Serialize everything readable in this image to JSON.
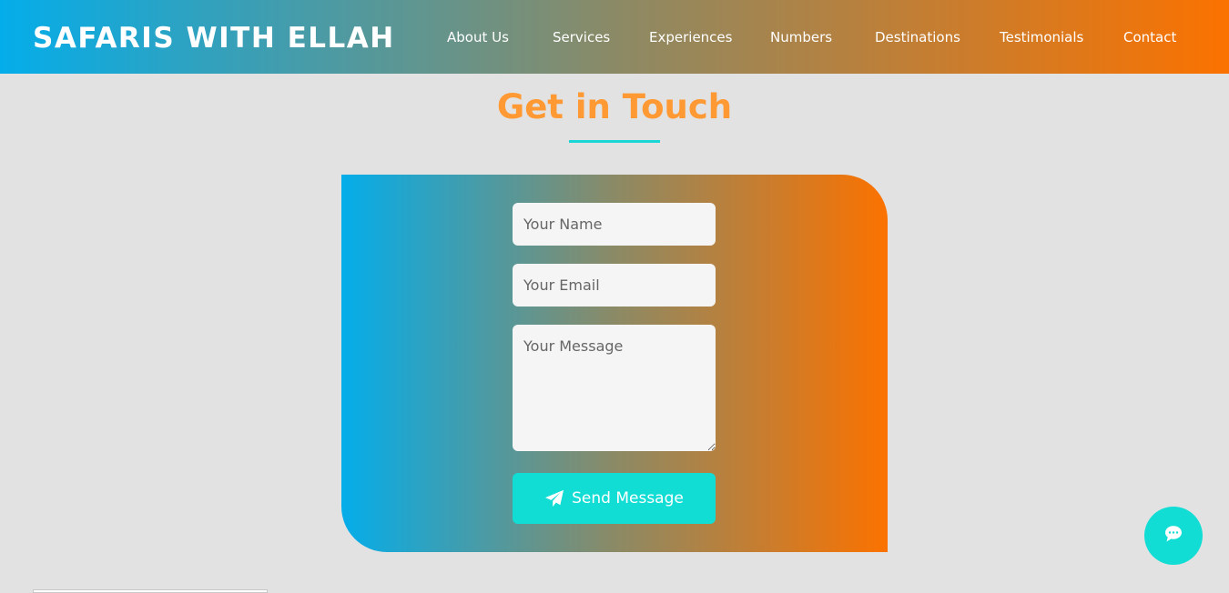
{
  "brand": {
    "title": "SAFARIS WITH ELLAH"
  },
  "nav": {
    "items": [
      {
        "label": "About Us"
      },
      {
        "label": "Services"
      },
      {
        "label": "Experiences"
      },
      {
        "label": "Numbers"
      },
      {
        "label": "Destinations"
      },
      {
        "label": "Testimonials"
      },
      {
        "label": "Contact"
      }
    ]
  },
  "contact": {
    "heading": "Get in Touch",
    "name_placeholder": "Your Name",
    "email_placeholder": "Your Email",
    "message_placeholder": "Your Message",
    "send_label": "Send Message",
    "send_icon": "paper-plane-icon"
  },
  "chat": {
    "icon": "chat-bubble-icon"
  },
  "colors": {
    "gradient_start": "#04adea",
    "gradient_end": "#fb7200",
    "heading": "#ff9933",
    "accent": "#12ddd5",
    "background": "#e2e2e2"
  }
}
